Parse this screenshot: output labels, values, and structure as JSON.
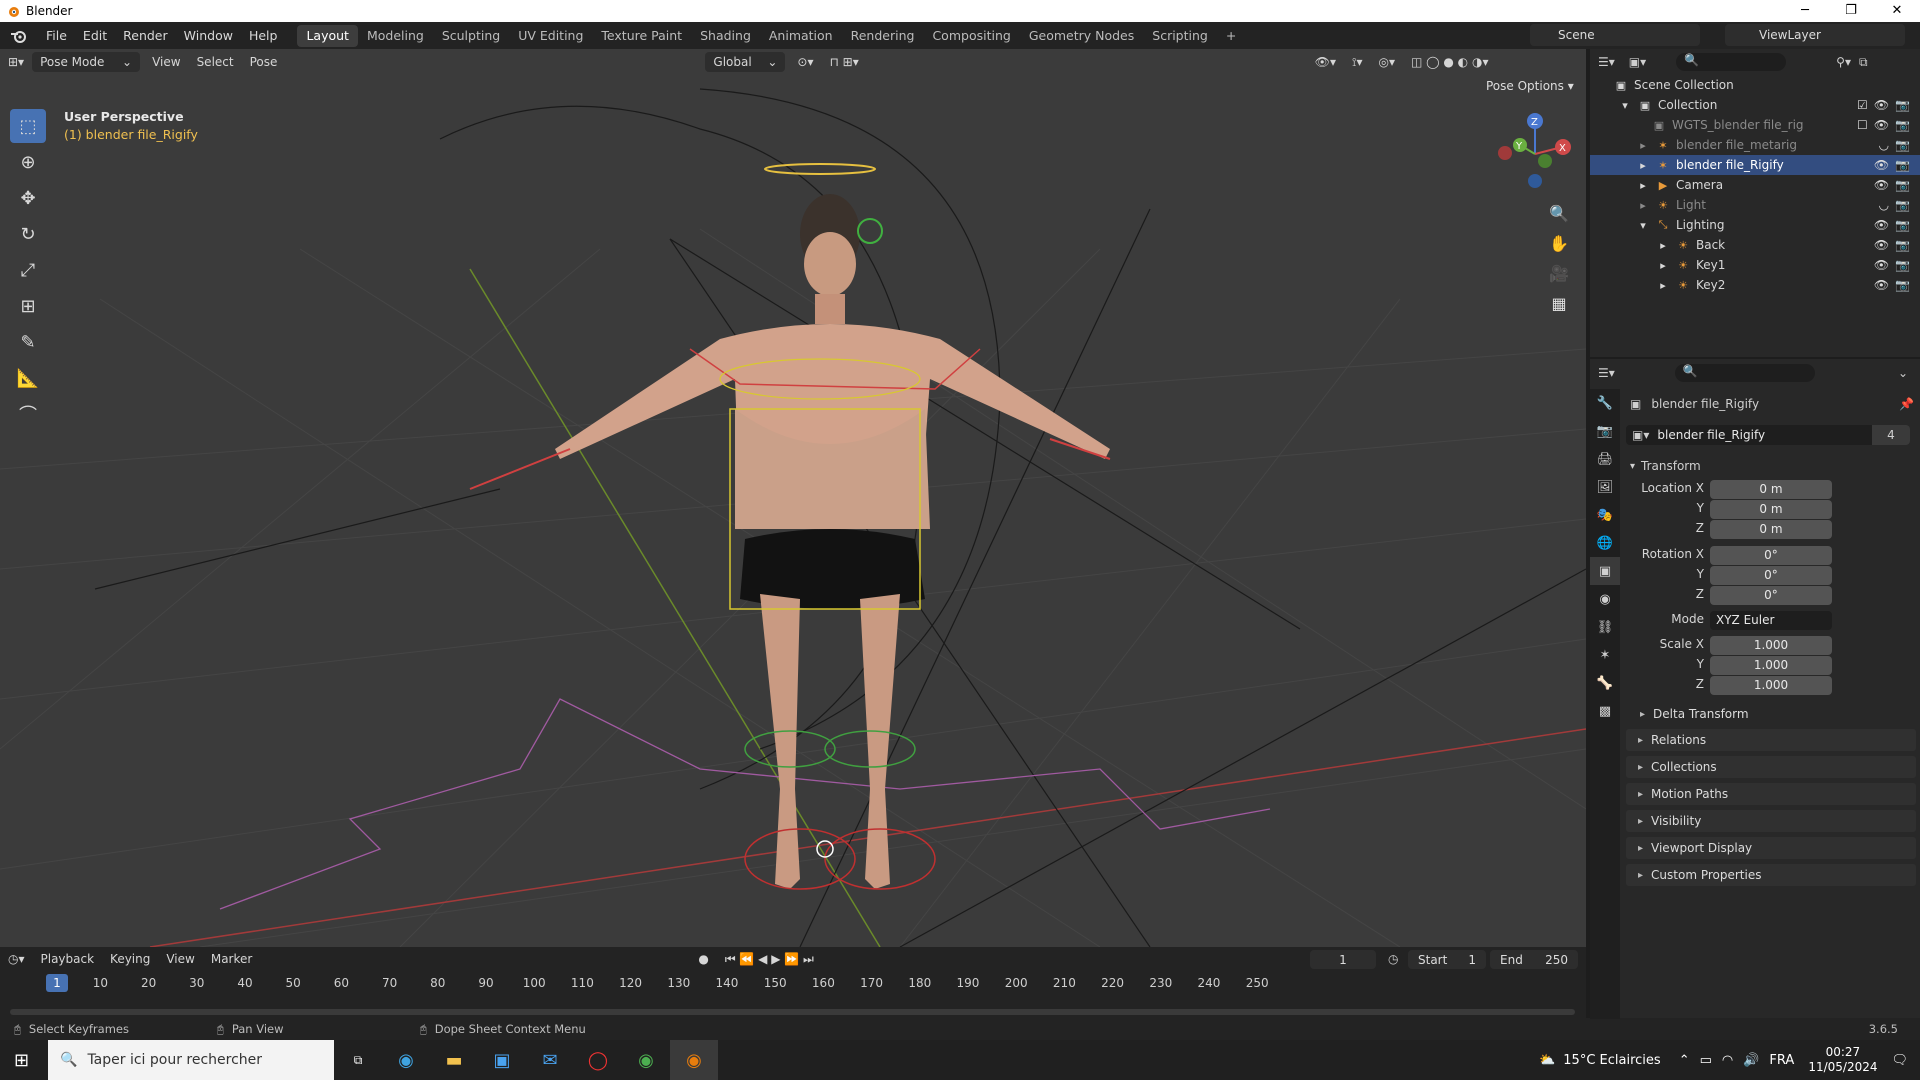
{
  "window": {
    "title": "Blender"
  },
  "menu": [
    "File",
    "Edit",
    "Render",
    "Window",
    "Help"
  ],
  "workspaces": [
    "Layout",
    "Modeling",
    "Sculpting",
    "UV Editing",
    "Texture Paint",
    "Shading",
    "Animation",
    "Rendering",
    "Compositing",
    "Geometry Nodes",
    "Scripting"
  ],
  "active_workspace": "Layout",
  "scene_name": "Scene",
  "view_layer": "ViewLayer",
  "viewport": {
    "mode": "Pose Mode",
    "menus": [
      "View",
      "Select",
      "Pose"
    ],
    "orientation": "Global",
    "pose_options": "Pose Options",
    "perspective": "User Perspective",
    "active_object": "(1) blender file_Rigify"
  },
  "outliner": {
    "title": "Scene Collection",
    "rows": [
      {
        "label": "Collection",
        "level": 1
      },
      {
        "label": "WGTS_blender file_rig",
        "level": 2
      },
      {
        "label": "blender file_metarig",
        "level": 2
      },
      {
        "label": "blender file_Rigify",
        "level": 2
      },
      {
        "label": "Camera",
        "level": 2
      },
      {
        "label": "Light",
        "level": 2
      },
      {
        "label": "Lighting",
        "level": 2
      },
      {
        "label": "Back",
        "level": 3
      },
      {
        "label": "Key1",
        "level": 3
      },
      {
        "label": "Key2",
        "level": 3
      }
    ]
  },
  "properties": {
    "object_name": "blender file_Rigify",
    "data_name": "blender file_Rigify",
    "users": "4",
    "transform_title": "Transform",
    "location": {
      "label": "Location X",
      "x": "0 m",
      "y": "0 m",
      "z": "0 m"
    },
    "rotation": {
      "label": "Rotation X",
      "x": "0°",
      "y": "0°",
      "z": "0°"
    },
    "mode_label": "Mode",
    "mode_value": "XYZ Euler",
    "scale": {
      "label": "Scale X",
      "x": "1.000",
      "y": "1.000",
      "z": "1.000"
    },
    "axis_y": "Y",
    "axis_z": "Z",
    "delta": "Delta Transform",
    "panels": [
      "Relations",
      "Collections",
      "Motion Paths",
      "Visibility",
      "Viewport Display",
      "Custom Properties"
    ]
  },
  "timeline": {
    "menus": [
      "Playback",
      "Keying",
      "View",
      "Marker"
    ],
    "current_frame": "1",
    "start_label": "Start",
    "start": "1",
    "end_label": "End",
    "end": "250",
    "ticks": [
      "10",
      "20",
      "30",
      "40",
      "50",
      "60",
      "70",
      "80",
      "90",
      "100",
      "110",
      "120",
      "130",
      "140",
      "150",
      "160",
      "170",
      "180",
      "190",
      "200",
      "210",
      "220",
      "230",
      "240",
      "250"
    ]
  },
  "statusbar": {
    "hint1": "Select Keyframes",
    "hint2": "Pan View",
    "hint3": "Dope Sheet Context Menu",
    "version": "3.6.5"
  },
  "taskbar": {
    "search_placeholder": "Taper ici pour rechercher",
    "weather": "15°C  Eclaircies",
    "lang": "FRA",
    "time": "00:27",
    "date": "11/05/2024"
  },
  "colors": {
    "accent": "#4772b3",
    "selection": "#334d80",
    "active_text": "#f0c050"
  }
}
